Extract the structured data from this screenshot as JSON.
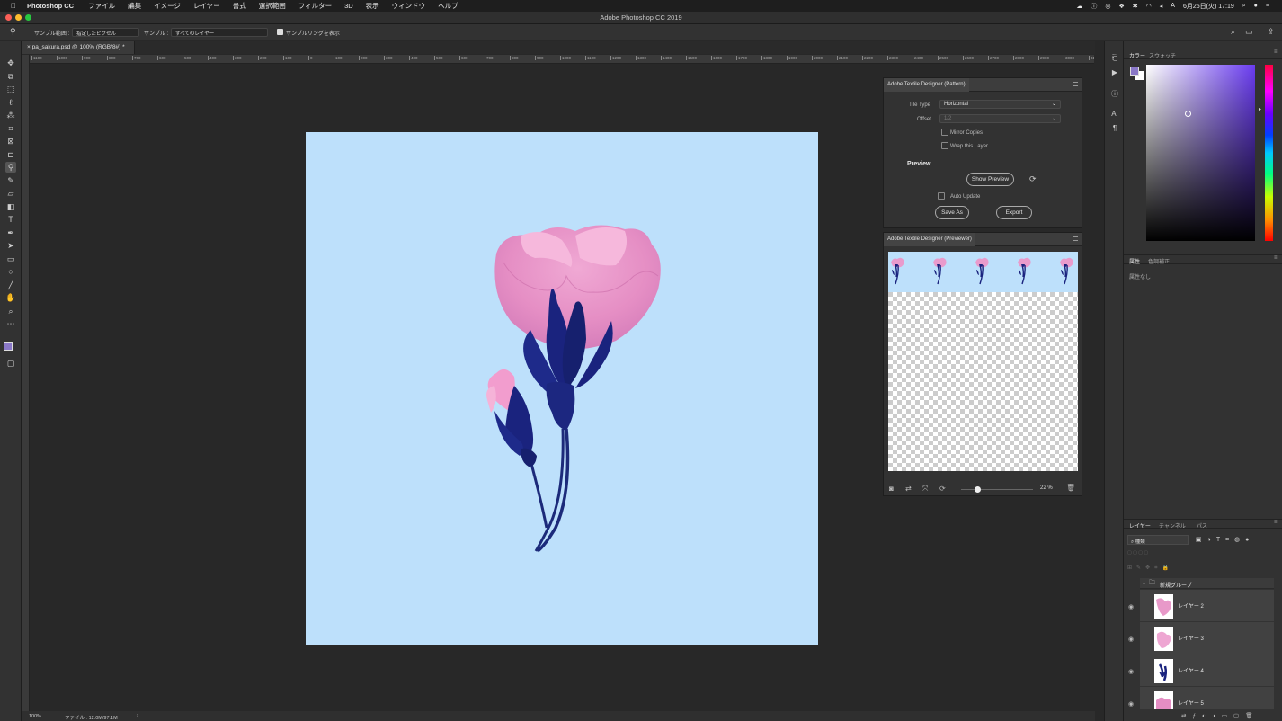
{
  "menubar": {
    "app_name": "Photoshop CC",
    "items": [
      "ファイル",
      "編集",
      "イメージ",
      "レイヤー",
      "書式",
      "選択範囲",
      "フィルター",
      "3D",
      "表示",
      "ウィンドウ",
      "ヘルプ"
    ],
    "clock": "6月25日(火) 17:19"
  },
  "window": {
    "title": "Adobe Photoshop CC 2019"
  },
  "options_bar": {
    "sample_size_label": "サンプル範囲 :",
    "sample_size_value": "指定したピクセル",
    "sample_label": "サンプル :",
    "sample_value": "すべてのレイヤー",
    "show_ring_label": "サンプルリングを表示"
  },
  "document": {
    "tab_title": "pa_sakura.psd @ 100% (RGB/8#) *",
    "zoom": "100%",
    "file_info": "ファイル : 12.0M/97.1M"
  },
  "ruler": {
    "ticks": [
      "1100",
      "1000",
      "900",
      "800",
      "700",
      "600",
      "500",
      "400",
      "300",
      "200",
      "100",
      "0",
      "100",
      "200",
      "300",
      "400",
      "500",
      "600",
      "700",
      "800",
      "900",
      "1000",
      "1100",
      "1200",
      "1300",
      "1400",
      "1500",
      "1600",
      "1700",
      "1800",
      "1900",
      "2000",
      "2100",
      "2200",
      "2300",
      "2400",
      "2500",
      "2600",
      "2700",
      "2800",
      "2900",
      "3000",
      "3100"
    ]
  },
  "pattern_panel": {
    "title": "Adobe Textile Designer (Pattern)",
    "tile_type_label": "Tile Type",
    "tile_type_value": "Horizontal",
    "offset_label": "Offset",
    "offset_value": "1/2",
    "mirror_label": "Mirror Copies",
    "wrap_label": "Wrap this Layer",
    "preview_heading": "Preview",
    "show_preview": "Show Preview",
    "auto_update": "Auto Update",
    "save_as": "Save As",
    "export": "Export"
  },
  "previewer_panel": {
    "title": "Adobe Textile Designer (Previewer)",
    "zoom_text": "22 %",
    "zoom_level": 0.22
  },
  "color_panel": {
    "tabs": [
      "カラー",
      "スウォッチ"
    ],
    "fg_color": "#8a78c8",
    "hue_color": "#6a3cf0"
  },
  "properties_panel": {
    "tabs": [
      "属性",
      "色調補正"
    ],
    "empty_text": "属性なし"
  },
  "layers_panel": {
    "tabs": [
      "レイヤー",
      "チャンネル",
      "パス"
    ],
    "filter_value": "種類",
    "group_name": "新規グループ",
    "layers": [
      {
        "name": "レイヤー 2"
      },
      {
        "name": "レイヤー 3"
      },
      {
        "name": "レイヤー 4"
      },
      {
        "name": "レイヤー 5"
      }
    ]
  }
}
